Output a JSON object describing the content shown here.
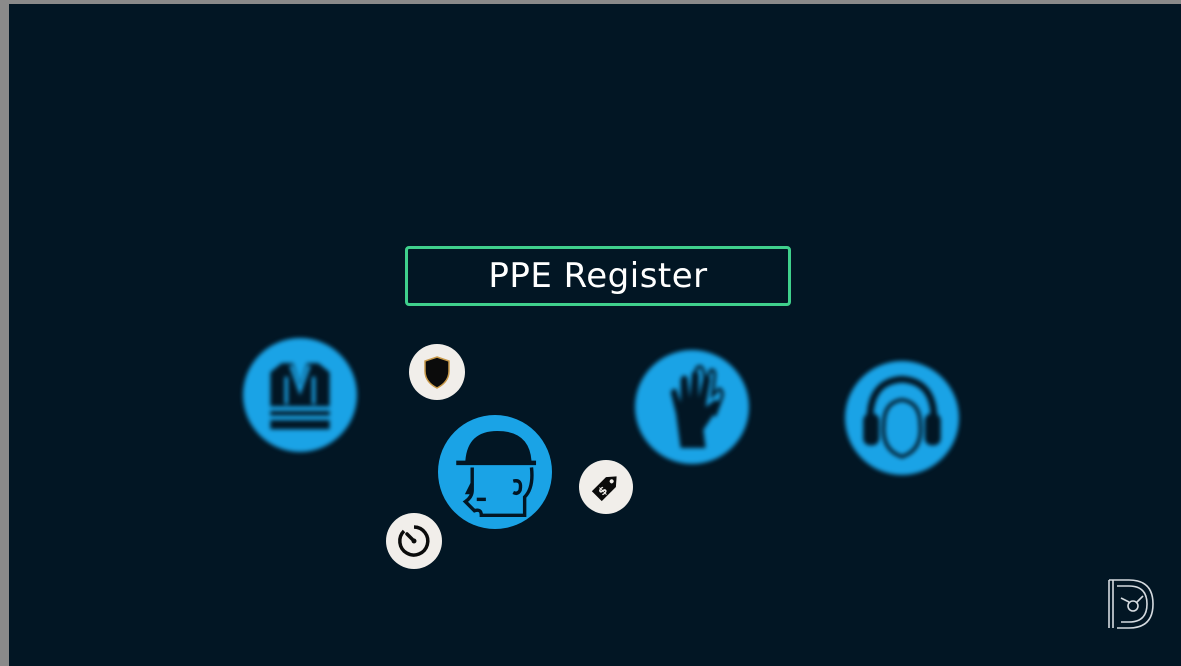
{
  "title": "PPE Register",
  "colors": {
    "background": "#021624",
    "frame": "#8a8a8a",
    "accent_border": "#3fd08c",
    "ppe_circle": "#1aa3e6",
    "small_circle": "#f1eeea"
  },
  "icons": {
    "ppe": [
      "hi-vis-vest-icon",
      "hard-hat-head-icon",
      "safety-gloves-icon",
      "ear-protection-icon"
    ],
    "small": [
      "shield-icon",
      "timer-icon",
      "price-tag-icon"
    ],
    "brand": "brand-logo-icon"
  }
}
